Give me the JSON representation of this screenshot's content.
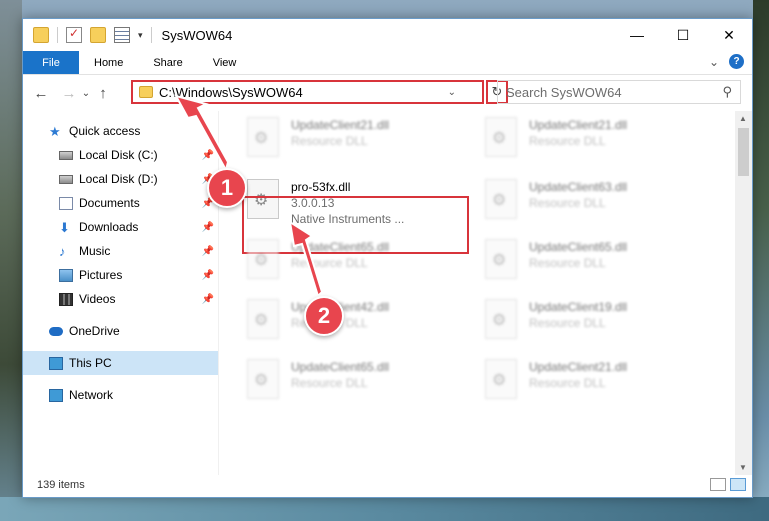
{
  "window": {
    "title": "SysWOW64",
    "minimize_glyph": "—",
    "maximize_glyph": "☐",
    "close_glyph": "✕"
  },
  "ribbon": {
    "tabs": [
      {
        "label": "File"
      },
      {
        "label": "Home"
      },
      {
        "label": "Share"
      },
      {
        "label": "View"
      }
    ],
    "expand_glyph": "⌄",
    "help_glyph": "?"
  },
  "nav": {
    "back_glyph": "←",
    "forward_glyph": "→",
    "recent_glyph": "⌄",
    "up_glyph": "↑",
    "address_path": "C:\\Windows\\SysWOW64",
    "address_chevron": "⌄",
    "refresh_glyph": "↻",
    "search_placeholder": "Search SysWOW64",
    "search_glyph": "⚲"
  },
  "sidebar": {
    "items": [
      {
        "label": "Quick access",
        "icon": "star-icon"
      },
      {
        "label": "Local Disk (C:)",
        "icon": "disk-icon"
      },
      {
        "label": "Local Disk (D:)",
        "icon": "disk-icon"
      },
      {
        "label": "Documents",
        "icon": "documents-icon"
      },
      {
        "label": "Downloads",
        "icon": "downloads-icon"
      },
      {
        "label": "Music",
        "icon": "music-icon"
      },
      {
        "label": "Pictures",
        "icon": "pictures-icon"
      },
      {
        "label": "Videos",
        "icon": "videos-icon"
      },
      {
        "label": "OneDrive",
        "icon": "onedrive-icon"
      },
      {
        "label": "This PC",
        "icon": "computer-icon"
      },
      {
        "label": "Network",
        "icon": "network-icon"
      }
    ],
    "pin_glyph": "📌"
  },
  "files": {
    "featured": {
      "name": "pro-53fx.dll",
      "version": "3.0.0.13",
      "company": "Native Instruments ..."
    },
    "blurred": [
      {
        "name": "UpdateClient21.dll",
        "type": "Resource DLL"
      },
      {
        "name": "UpdateClient21.dll",
        "type": "Resource DLL"
      },
      {
        "name": "UpdateClient63.dll",
        "type": "Resource DLL"
      },
      {
        "name": "UpdateClient65.dll",
        "type": "Resource DLL"
      },
      {
        "name": "UpdateClient65.dll",
        "type": "Resource DLL"
      },
      {
        "name": "UpdateClient42.dll",
        "type": "Resource DLL"
      },
      {
        "name": "UpdateClient19.dll",
        "type": "Resource DLL"
      },
      {
        "name": "UpdateClient65.dll",
        "type": "Resource DLL"
      },
      {
        "name": "UpdateClient21.dll",
        "type": "Resource DLL"
      }
    ]
  },
  "status": {
    "item_count": "139 items"
  },
  "annotations": {
    "step1": "1",
    "step2": "2",
    "color": "#e8454e"
  }
}
